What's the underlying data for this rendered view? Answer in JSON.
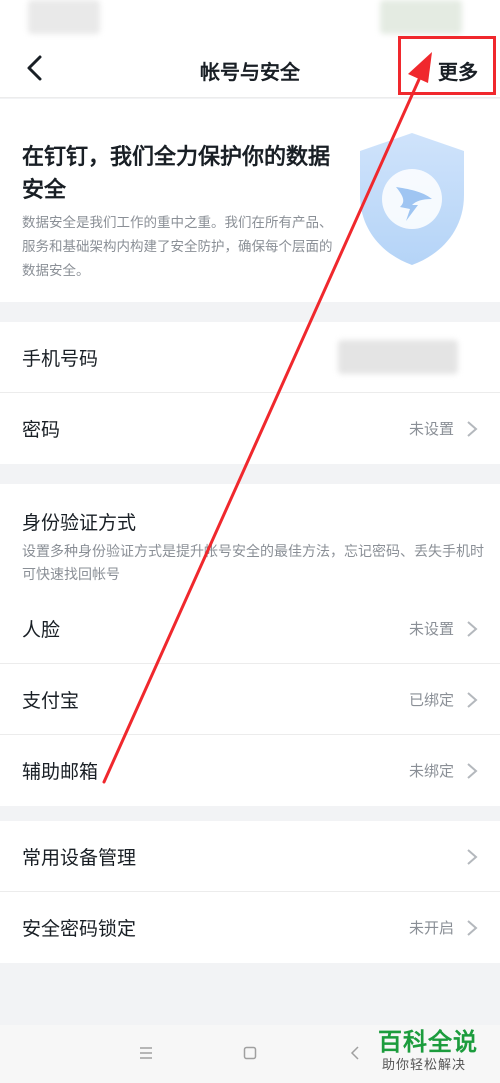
{
  "navbar": {
    "title": "帐号与安全",
    "more_label": "更多"
  },
  "hero": {
    "title": "在钉钉，我们全力保护你的数据安全",
    "description": "数据安全是我们工作的重中之重。我们在所有产品、服务和基础架构内构建了安全防护，确保每个层面的数据安全。"
  },
  "account": {
    "phone_label": "手机号码",
    "password_label": "密码",
    "password_value": "未设置"
  },
  "verification": {
    "title": "身份验证方式",
    "description": "设置多种身份验证方式是提升帐号安全的最佳方法，忘记密码、丢失手机时可快速找回帐号",
    "items": [
      {
        "label": "人脸",
        "value": "未设置"
      },
      {
        "label": "支付宝",
        "value": "已绑定"
      },
      {
        "label": "辅助邮箱",
        "value": "未绑定"
      }
    ]
  },
  "devices": {
    "items": [
      {
        "label": "常用设备管理",
        "value": ""
      },
      {
        "label": "安全密码锁定",
        "value": "未开启"
      }
    ]
  },
  "watermark": {
    "title": "百科全说",
    "subtitle": "助你轻松解决"
  },
  "colors": {
    "annotation": "#f0282d",
    "accent": "#3296fa",
    "watermark": "#1c9c3d"
  }
}
